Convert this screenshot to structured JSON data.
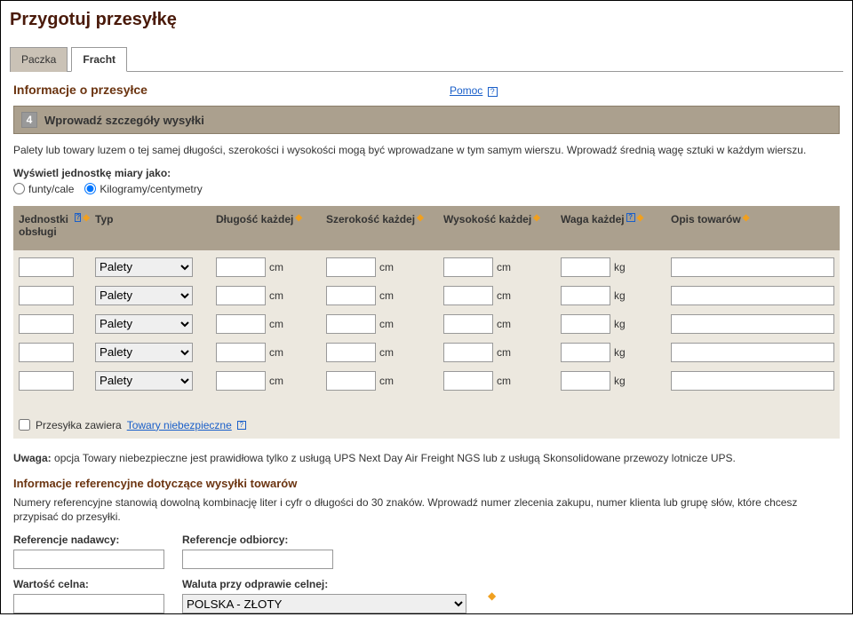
{
  "page_title": "Przygotuj przesyłkę",
  "tabs": {
    "package": "Paczka",
    "freight": "Fracht"
  },
  "section_title": "Informacje o przesyłce",
  "help_label": "Pomoc",
  "step": {
    "num": "4",
    "label": "Wprowadź szczegóły wysyłki"
  },
  "intro_text": "Palety lub towary luzem o tej samej długości, szerokości i wysokości mogą być wprowadzane w tym samym wierszu. Wprowadź średnią wagę sztuki w każdym wierszu.",
  "unit_label": "Wyświetl jednostkę miary jako:",
  "unit_lbs": "funty/cale",
  "unit_kg": "Kilogramy/centymetry",
  "columns": {
    "qty": "Jednostki obsługi",
    "type": "Typ",
    "length": "Długość każdej",
    "width": "Szerokość każdej",
    "height": "Wysokość każdej",
    "weight": "Waga każdej",
    "desc": "Opis towarów"
  },
  "type_option": "Palety",
  "dim_unit": "cm",
  "weight_unit": "kg",
  "hazmat_label": "Przesyłka zawiera",
  "hazmat_link": "Towary niebezpieczne",
  "note_bold": "Uwaga:",
  "note_text": " opcja Towary niebezpieczne jest prawidłowa tylko z usługą UPS Next Day Air Freight NGS lub z usługą Skonsolidowane przewozy lotnicze UPS.",
  "ref_title": "Informacje referencyjne dotyczące wysyłki towarów",
  "ref_text": "Numery referencyjne stanowią dowolną kombinację liter i cyfr o długości do 30 znaków. Wprowadź numer zlecenia zakupu, numer klienta lub grupę słów, które chcesz przypisać do przesyłki.",
  "ref_sender": "Referencje nadawcy:",
  "ref_receiver": "Referencje odbiorcy:",
  "customs_value": "Wartość celna:",
  "customs_currency": "Waluta przy odprawie celnej:",
  "currency_option": "POLSKA - ZŁOTY"
}
